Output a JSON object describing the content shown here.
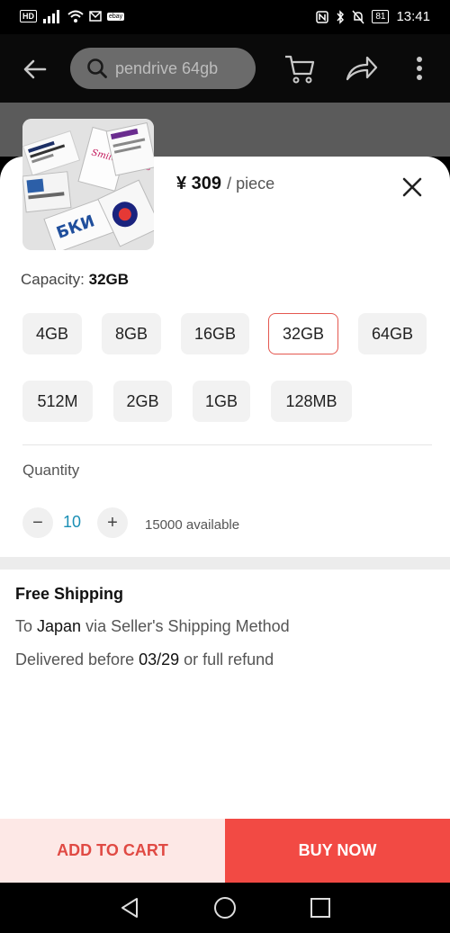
{
  "status_bar": {
    "left_badges": [
      "HD",
      "ebay"
    ],
    "battery": "81",
    "time": "13:41"
  },
  "header": {
    "search_text": "pendrive 64gb"
  },
  "product": {
    "price": "¥ 309",
    "unit": "/ piece",
    "thumbnail_card_texts": [
      "БКИ",
      "Smile Sweets"
    ]
  },
  "capacity": {
    "label": "Capacity:",
    "selected_value": "32GB",
    "options": [
      "4GB",
      "8GB",
      "16GB",
      "32GB",
      "64GB",
      "512M",
      "2GB",
      "1GB",
      "128MB"
    ]
  },
  "quantity": {
    "label": "Quantity",
    "minus": "−",
    "value": "10",
    "plus": "+",
    "available": "15000 available"
  },
  "shipping": {
    "title": "Free Shipping",
    "line1_prefix": "To ",
    "line1_country": "Japan",
    "line1_suffix": " via Seller's Shipping Method",
    "line2_prefix": "Delivered before ",
    "line2_date": "03/29",
    "line2_suffix": " or full refund"
  },
  "actions": {
    "add_to_cart": "ADD TO CART",
    "buy_now": "BUY NOW"
  },
  "colors": {
    "accent": "#f24a44",
    "selected_border": "#e4574f",
    "quantity_value": "#1b8fb5"
  }
}
